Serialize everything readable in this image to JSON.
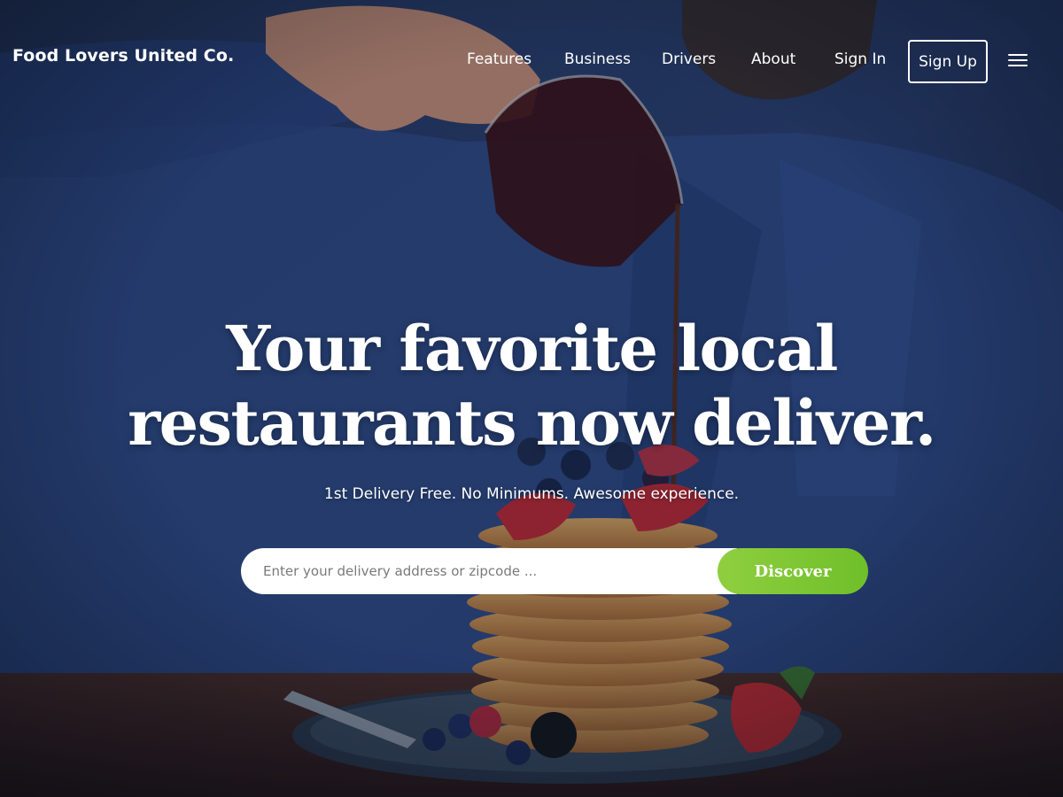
{
  "brand": {
    "name": "Food Lovers United Co."
  },
  "nav": {
    "items": [
      {
        "label": "Features"
      },
      {
        "label": "Business"
      },
      {
        "label": "Drivers"
      },
      {
        "label": "About"
      },
      {
        "label": "Sign In"
      }
    ],
    "signup_label": "Sign Up",
    "menu_icon": "hamburger-menu-icon"
  },
  "hero": {
    "headline_line1": "Your favorite local",
    "headline_line2": "restaurants now deliver.",
    "subheadline": "1st Delivery Free. No Minimums. Awesome experience."
  },
  "search": {
    "placeholder": "Enter your delivery address or zipcode ...",
    "value": "",
    "button_label": "Discover"
  },
  "colors": {
    "accent": "#7cc733",
    "overlay": "#1e3566",
    "text": "#ffffff"
  }
}
